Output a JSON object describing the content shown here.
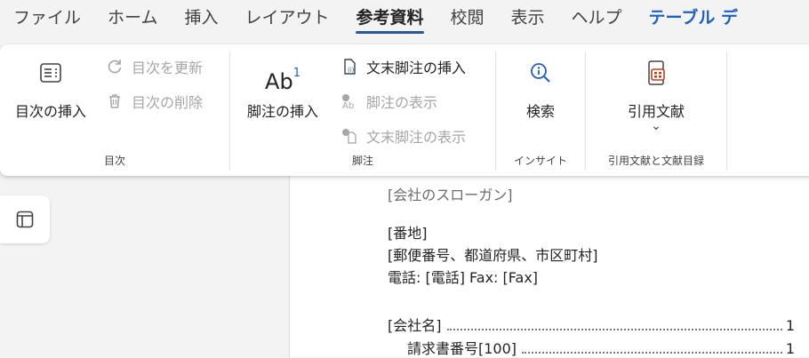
{
  "tabs": [
    "ファイル",
    "ホーム",
    "挿入",
    "レイアウト",
    "参考資料",
    "校閲",
    "表示",
    "ヘルプ",
    "テーブル デ"
  ],
  "toc_group": {
    "insert_toc": "目次の挿入",
    "update_toc": "目次を更新",
    "remove_toc": "目次の削除",
    "label": "目次"
  },
  "footnote_group": {
    "insert_footnote": "脚注の挿入",
    "footnote_icon_text": "Ab",
    "footnote_icon_sup": "1",
    "insert_endnote": "文末脚注の挿入",
    "show_footnotes": "脚注の表示",
    "show_endnotes": "文末脚注の表示",
    "label": "脚注"
  },
  "insights_group": {
    "search": "検索",
    "label": "インサイト"
  },
  "citations_group": {
    "citations": "引用文献",
    "chevron": "⌄",
    "label": "引用文献と文献目録"
  },
  "document": {
    "slogan": "[会社のスローガン]",
    "address": "[番地]",
    "postal": "[郵便番号、都道府県、市区町村]",
    "phone_fax": "電話: [電話] Fax: [Fax]",
    "toc_entries": [
      {
        "text": "[会社名]",
        "page": "1"
      },
      {
        "text": "請求書番号[100]",
        "page": "1"
      }
    ]
  },
  "colors": {
    "accent": "#2b5797",
    "context_tab": "#1f5fbf",
    "citation_icon": "#c43e1c"
  }
}
